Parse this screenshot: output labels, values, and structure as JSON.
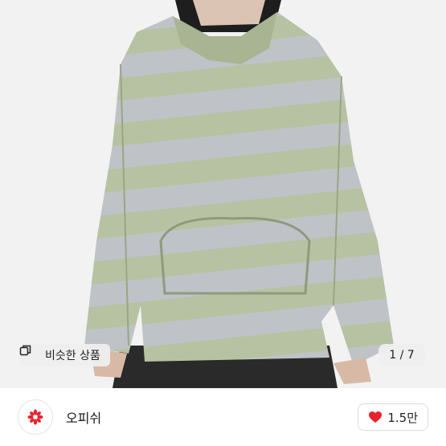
{
  "product_image": {
    "alt_icon": "striped-hoodie-photo"
  },
  "similar_button": {
    "label": "비슷한 상품",
    "icon": "similar-items-icon"
  },
  "pagination": {
    "current": 1,
    "total": 7,
    "text": "1 / 7"
  },
  "shop": {
    "name": "오피쉬",
    "avatar_icon": "flower-logo-icon",
    "accent_color": "#e8232d"
  },
  "like": {
    "count_label": "1.5만",
    "icon": "heart-icon",
    "color": "#e8232d"
  }
}
